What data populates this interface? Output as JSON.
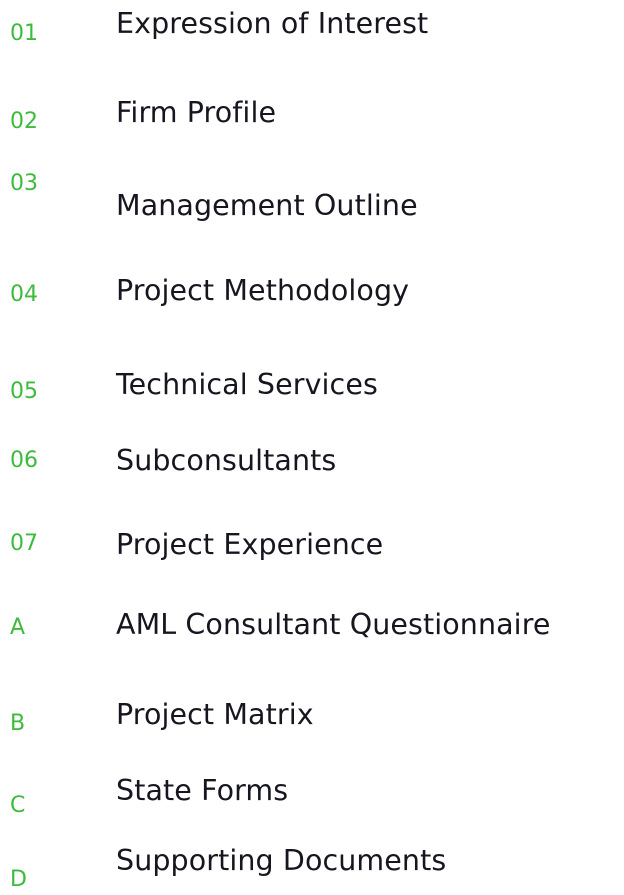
{
  "toc": {
    "accent_color": "#3dbb3d",
    "text_color": "#161620",
    "items": [
      {
        "number": "01",
        "title": "Expression of Interest"
      },
      {
        "number": "02",
        "title": "Firm Profile"
      },
      {
        "number": "03",
        "title": "Management Outline"
      },
      {
        "number": "04",
        "title": "Project Methodology"
      },
      {
        "number": "05",
        "title": "Technical Services"
      },
      {
        "number": "06",
        "title": "Subconsultants"
      },
      {
        "number": "07",
        "title": "Project Experience"
      },
      {
        "number": "A",
        "title": "AML Consultant Questionnaire"
      },
      {
        "number": "B",
        "title": "Project Matrix"
      },
      {
        "number": "C",
        "title": "State Forms"
      },
      {
        "number": "D",
        "title": "Supporting Documents"
      }
    ]
  }
}
